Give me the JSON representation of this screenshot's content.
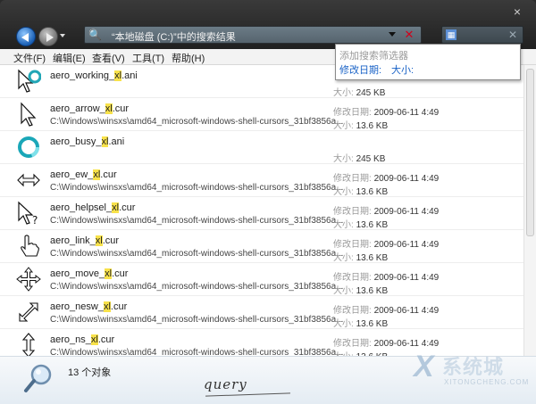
{
  "window": {
    "close_label": "×"
  },
  "address": {
    "text": "“本地磁盘 (C:)”中的搜索结果",
    "clear": "✕"
  },
  "search": {
    "clear": "✕"
  },
  "menu": [
    {
      "label": "文件(F)"
    },
    {
      "label": "编辑(E)"
    },
    {
      "label": "查看(V)"
    },
    {
      "label": "工具(T)"
    },
    {
      "label": "帮助(H)"
    }
  ],
  "filter_popup": {
    "title": "添加搜索筛选器",
    "filter1": "修改日期:",
    "filter2": "大小:"
  },
  "labels": {
    "date": "修改日期:",
    "size": "大小:"
  },
  "files": [
    {
      "pre": "aero_working_",
      "hl": "xl",
      "post": ".ani",
      "path": "",
      "date": "",
      "size": "245 KB",
      "icon": "working-cursor-icon"
    },
    {
      "pre": "aero_arrow_",
      "hl": "xl",
      "post": ".cur",
      "path": "C:\\Windows\\winsxs\\amd64_microsoft-windows-shell-cursors_31bf3856a...",
      "date": "2009-06-11 4:49",
      "size": "13.6 KB",
      "icon": "arrow-cursor-icon"
    },
    {
      "pre": "aero_busy_",
      "hl": "xl",
      "post": ".ani",
      "path": "",
      "date": "",
      "size": "245 KB",
      "icon": "busy-cursor-icon"
    },
    {
      "pre": "aero_ew_",
      "hl": "xl",
      "post": ".cur",
      "path": "C:\\Windows\\winsxs\\amd64_microsoft-windows-shell-cursors_31bf3856a...",
      "date": "2009-06-11 4:49",
      "size": "13.6 KB",
      "icon": "ew-resize-cursor-icon"
    },
    {
      "pre": "aero_helpsel_",
      "hl": "xl",
      "post": ".cur",
      "path": "C:\\Windows\\winsxs\\amd64_microsoft-windows-shell-cursors_31bf3856a...",
      "date": "2009-06-11 4:49",
      "size": "13.6 KB",
      "icon": "help-cursor-icon"
    },
    {
      "pre": "aero_link_",
      "hl": "xl",
      "post": ".cur",
      "path": "C:\\Windows\\winsxs\\amd64_microsoft-windows-shell-cursors_31bf3856a...",
      "date": "2009-06-11 4:49",
      "size": "13.6 KB",
      "icon": "hand-cursor-icon"
    },
    {
      "pre": "aero_move_",
      "hl": "xl",
      "post": ".cur",
      "path": "C:\\Windows\\winsxs\\amd64_microsoft-windows-shell-cursors_31bf3856a...",
      "date": "2009-06-11 4:49",
      "size": "13.6 KB",
      "icon": "move-cursor-icon"
    },
    {
      "pre": "aero_nesw_",
      "hl": "xl",
      "post": ".cur",
      "path": "C:\\Windows\\winsxs\\amd64_microsoft-windows-shell-cursors_31bf3856a...",
      "date": "2009-06-11 4:49",
      "size": "13.6 KB",
      "icon": "nesw-resize-cursor-icon"
    },
    {
      "pre": "aero_ns_",
      "hl": "xl",
      "post": ".cur",
      "path": "C:\\Windows\\winsxs\\amd64_microsoft-windows-shell-cursors_31bf3856a...",
      "date": "2009-06-11 4:49",
      "size": "13.6 KB",
      "icon": "ns-resize-cursor-icon"
    }
  ],
  "status": {
    "count": "13 个对象",
    "query": "query"
  },
  "watermark": {
    "text": "系统城",
    "sub": "XITONGCHENG.COM"
  }
}
